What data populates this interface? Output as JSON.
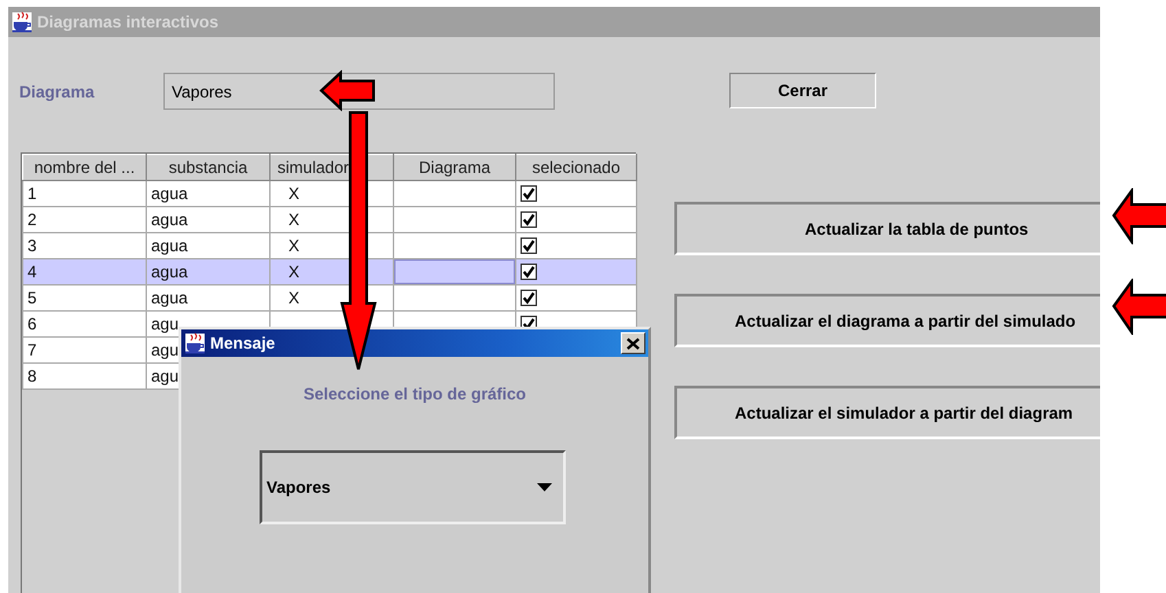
{
  "window": {
    "title": "Diagramas interactivos"
  },
  "diagram_field": {
    "label": "Diagrama",
    "value": "Vapores"
  },
  "close_button": "Cerrar",
  "table": {
    "columns": [
      "nombre del ...",
      "substancia",
      "simulador",
      "Diagrama",
      "selecionado"
    ],
    "rows": [
      {
        "name": "1",
        "substancia": "agua",
        "simulador": "X",
        "checked": true,
        "selected": false
      },
      {
        "name": "2",
        "substancia": "agua",
        "simulador": "X",
        "checked": true,
        "selected": false
      },
      {
        "name": "3",
        "substancia": "agua",
        "simulador": "X",
        "checked": true,
        "selected": false
      },
      {
        "name": "4",
        "substancia": "agua",
        "simulador": "X",
        "checked": true,
        "selected": true
      },
      {
        "name": "5",
        "substancia": "agua",
        "simulador": "X",
        "checked": true,
        "selected": false
      },
      {
        "name": "6",
        "substancia": "agu",
        "checked": true,
        "selected": false
      },
      {
        "name": "7",
        "substancia": "agu",
        "selected": false
      },
      {
        "name": "8",
        "substancia": "agu",
        "selected": false
      }
    ]
  },
  "actions": [
    "Actualizar la tabla de puntos",
    "Actualizar el diagrama a partir del simulado",
    "Actualizar el simulador a partir del diagram"
  ],
  "dialog": {
    "title": "Mensaje",
    "message": "Seleccione el tipo de gráfico",
    "select": {
      "value": "Vapores"
    }
  }
}
